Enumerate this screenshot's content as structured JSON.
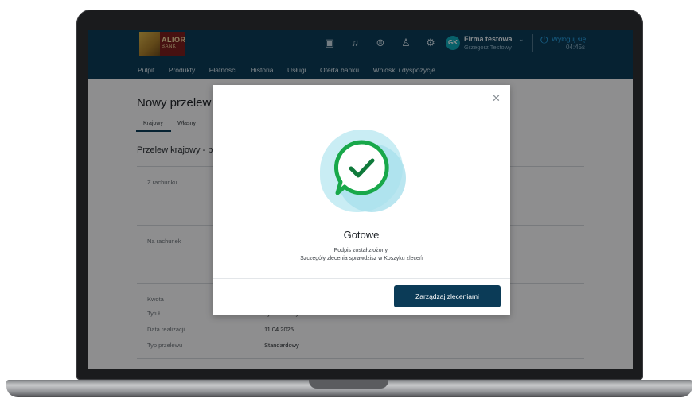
{
  "header": {
    "logo_text": "ALIOR",
    "logo_sub": "BANK",
    "icons": [
      "safe-icon",
      "bell-icon",
      "currency-icon",
      "user-icon",
      "settings-icon"
    ],
    "avatar_initials": "GK",
    "company": "Firma testowa",
    "person": "Grzegorz Testowy",
    "logout_label": "Wyloguj się",
    "session_timer": "04:45s"
  },
  "nav": {
    "items": [
      "Pulpit",
      "Produkty",
      "Płatności",
      "Historia",
      "Usługi",
      "Oferta banku",
      "Wnioski i dyspozycje"
    ]
  },
  "page": {
    "title": "Nowy przelew",
    "tabs": [
      "Krajowy",
      "Własny"
    ],
    "section_title": "Przelew krajowy - po",
    "fields": {
      "from_label": "Z rachunku",
      "to_label": "Na rachunek",
      "amount_label": "Kwota",
      "title_label": "Tytuł",
      "title_value": "Tytuł testowy",
      "date_label": "Data realizacji",
      "date_value": "11.04.2025",
      "type_label": "Typ przelewu",
      "type_value": "Standardowy"
    }
  },
  "modal": {
    "title": "Gotowe",
    "message_line1": "Podpis został złożony.",
    "message_line2": "Szczegóły zlecenia sprawdzisz w Koszyku zleceń",
    "button_label": "Zarządzaj zleceniami"
  },
  "colors": {
    "header_bg": "#0b3b57",
    "accent": "#2aa4e6",
    "success": "#18a84a",
    "primary_button": "#0b3b57"
  }
}
